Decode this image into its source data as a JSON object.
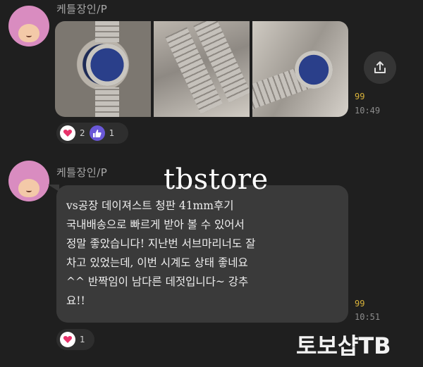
{
  "messages": [
    {
      "sender": "케틀장인/P",
      "attachment": {
        "type": "photo-grid",
        "count": 3
      },
      "read_count": "99",
      "time": "10:49",
      "reactions": [
        {
          "icon": "heart-icon",
          "count": "2"
        },
        {
          "icon": "thumbs-up-icon",
          "count": "1"
        }
      ]
    },
    {
      "sender": "케틀장인/P",
      "text": "vs공장 데이져스트 청판 41mm후기\n국내배송으로 빠르게 받아 볼 수 있어서\n정말 좋았습니다! 지난번 서브마리너도 잘\n차고 있었는데, 이번 시계도 상태 좋네요\n^^ 반짝임이 남다른 데젓입니다~ 강추\n요!!",
      "read_count": "99",
      "time": "10:51",
      "reactions": [
        {
          "icon": "heart-icon",
          "count": "1"
        }
      ]
    }
  ],
  "watermarks": {
    "center": "tbstore",
    "corner": "토보샵TB"
  },
  "share_button_icon": "share-icon",
  "colors": {
    "background": "#1f1f1f",
    "bubble": "#3a3a3a",
    "read_count": "#d8b23a",
    "heart": "#e8336b",
    "thumb": "#6a58d8"
  }
}
